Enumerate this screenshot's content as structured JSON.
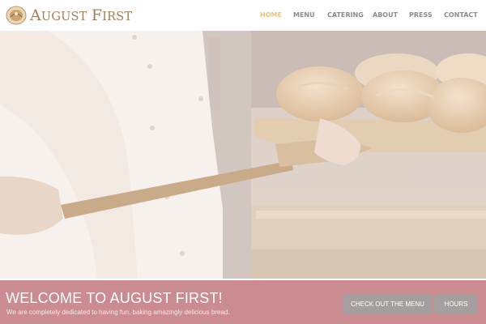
{
  "header": {
    "logo_text_first_letter_1": "A",
    "logo_text_rest_1": "UGUST",
    "logo_text_first_letter_2": "F",
    "logo_text_rest_2": "IRST"
  },
  "nav": {
    "items": [
      {
        "label": "HOME",
        "active": true
      },
      {
        "label": "MENU",
        "active": false
      },
      {
        "label": "CATERING",
        "active": false
      },
      {
        "label": "ABOUT",
        "active": false
      },
      {
        "label": "PRESS",
        "active": false
      },
      {
        "label": "CONTACT",
        "active": false
      }
    ]
  },
  "hero": {
    "image": "baker-pulling-bread-loaves-from-oven"
  },
  "welcome": {
    "title": "WELCOME TO AUGUST FIRST!",
    "subtitle": "We are completely dedicated to having fun, baking amazingly delicious bread.",
    "menu_button_label": "CHECK OUT THE MENU",
    "hours_button_label": "HOURS"
  },
  "colors": {
    "accent_active": "#f0c27a",
    "nav_text": "#8b8b8b",
    "band": "#cb8c91",
    "button": "#a59e9e",
    "logo": "#9e7f5a"
  }
}
